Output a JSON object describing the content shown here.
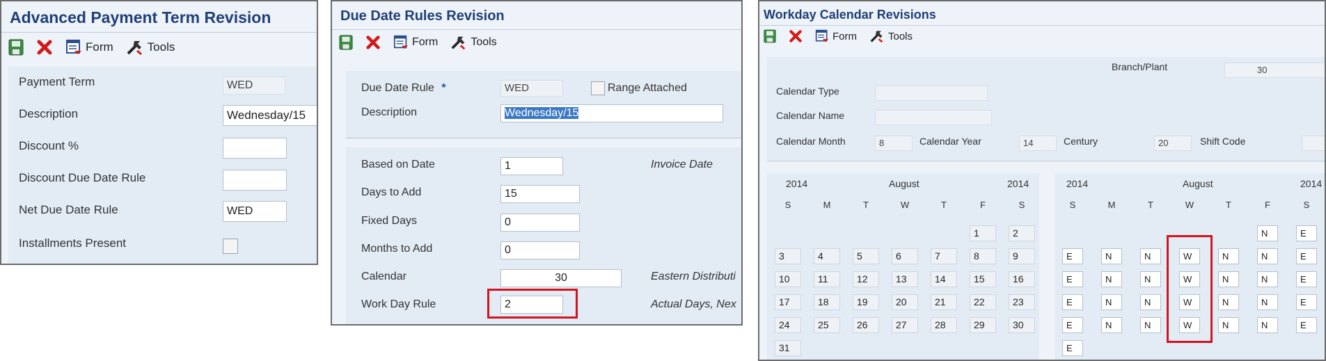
{
  "colors": {
    "title": "#1f3f77",
    "highlight": "#d4141c",
    "selection": "#3a78c6"
  },
  "toolbar": {
    "form_label": "Form",
    "tools_label": "Tools",
    "save_icon": "save-icon",
    "close_icon": "close-x-icon",
    "form_icon": "form-icon",
    "tools_icon": "tools-icon"
  },
  "apt": {
    "title": "Advanced Payment Term Revision",
    "payment_term_label": "Payment Term",
    "payment_term": "WED",
    "description_label": "Description",
    "description": "Wednesday/15",
    "discount_pct_label": "Discount %",
    "discount_pct": "",
    "discount_due_label": "Discount Due Date Rule",
    "discount_due": "",
    "net_due_label": "Net Due Date Rule",
    "net_due": "WED",
    "installments_label": "Installments Present"
  },
  "ddr": {
    "title": "Due Date Rules Revision",
    "rule_label": "Due Date Rule",
    "required_mark": "*",
    "rule": "WED",
    "range_label": "Range Attached",
    "description_label": "Description",
    "description": "Wednesday/15",
    "based_on_label": "Based on Date",
    "based_on": "1",
    "based_on_desc": "Invoice Date",
    "days_add_label": "Days to Add",
    "days_add": "15",
    "fixed_days_label": "Fixed Days",
    "fixed_days": "0",
    "months_add_label": "Months to Add",
    "months_add": "0",
    "calendar_label": "Calendar",
    "calendar": "30",
    "calendar_desc": "Eastern Distributi",
    "work_day_label": "Work Day Rule",
    "work_day": "2",
    "work_day_desc": "Actual Days, Nex"
  },
  "wcr": {
    "title": "Workday Calendar Revisions",
    "branch_label": "Branch/Plant",
    "branch": "30",
    "cal_type_label": "Calendar Type",
    "cal_type": "",
    "cal_name_label": "Calendar Name",
    "cal_name": "",
    "cal_month_label": "Calendar Month",
    "cal_month": "8",
    "cal_year_label": "Calendar Year",
    "cal_year": "14",
    "century_label": "Century",
    "century": "20",
    "shift_label": "Shift Code",
    "shift": "",
    "left_cal": {
      "year_left": "2014",
      "month": "August",
      "year_right": "2014"
    },
    "right_cal": {
      "year_left": "2014",
      "month": "August",
      "year_right": "2014"
    },
    "dow": [
      "S",
      "M",
      "T",
      "W",
      "T",
      "F",
      "S"
    ],
    "days": [
      [
        "",
        "",
        "",
        "",
        "",
        "1",
        "2"
      ],
      [
        "3",
        "4",
        "5",
        "6",
        "7",
        "8",
        "9"
      ],
      [
        "10",
        "11",
        "12",
        "13",
        "14",
        "15",
        "16"
      ],
      [
        "17",
        "18",
        "19",
        "20",
        "21",
        "22",
        "23"
      ],
      [
        "24",
        "25",
        "26",
        "27",
        "28",
        "29",
        "30"
      ],
      [
        "31",
        "",
        "",
        "",
        "",
        "",
        ""
      ]
    ],
    "workdays": [
      [
        "",
        "",
        "",
        "",
        "",
        "N",
        "E"
      ],
      [
        "E",
        "N",
        "N",
        "W",
        "N",
        "N",
        "E"
      ],
      [
        "E",
        "N",
        "N",
        "W",
        "N",
        "N",
        "E"
      ],
      [
        "E",
        "N",
        "N",
        "W",
        "N",
        "N",
        "E"
      ],
      [
        "E",
        "N",
        "N",
        "W",
        "N",
        "N",
        "E"
      ],
      [
        "E",
        "",
        "",
        "",
        "",
        "",
        ""
      ]
    ]
  }
}
